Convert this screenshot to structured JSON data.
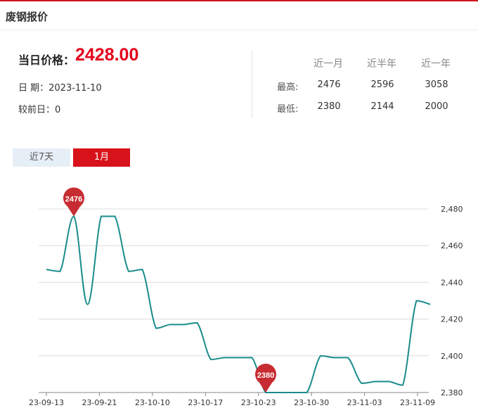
{
  "header": {
    "title": "废钢报价"
  },
  "summary": {
    "price_label": "当日价格：",
    "price": "2428.00",
    "date_label": "日 期：",
    "date": "2023-11-10",
    "diff_label": "较前日：",
    "diff": "0"
  },
  "stats": {
    "columns": [
      "近一月",
      "近半年",
      "近一年"
    ],
    "rows": [
      {
        "label": "最高:",
        "values": [
          "2476",
          "2596",
          "3058"
        ]
      },
      {
        "label": "最低:",
        "values": [
          "2380",
          "2144",
          "2000"
        ]
      }
    ]
  },
  "tabs": [
    {
      "label": "近7天",
      "active": false
    },
    {
      "label": "1月",
      "active": true
    }
  ],
  "chart_data": {
    "type": "line",
    "x_tick_labels": [
      "23-09-13",
      "23-09-21",
      "23-10-10",
      "23-10-17",
      "23-10-23",
      "23-10-30",
      "23-11-03",
      "23-11-09"
    ],
    "y_tick_labels": [
      "2,380",
      "2,400",
      "2,420",
      "2,440",
      "2,460",
      "2,480"
    ],
    "ylim": [
      2380,
      2480
    ],
    "values": [
      2447,
      2446,
      2476,
      2428,
      2476,
      2476,
      2446,
      2447,
      2415,
      2417,
      2417,
      2418,
      2398,
      2399,
      2399,
      2399,
      2380,
      2380,
      2380,
      2380,
      2400,
      2399,
      2399,
      2385,
      2386,
      2386,
      2384,
      2430,
      2428
    ],
    "series_color": "#1a8c8c",
    "markers": [
      {
        "label": "2476",
        "index": 2,
        "value": 2476
      },
      {
        "label": "2380",
        "index": 16,
        "value": 2380
      }
    ]
  }
}
